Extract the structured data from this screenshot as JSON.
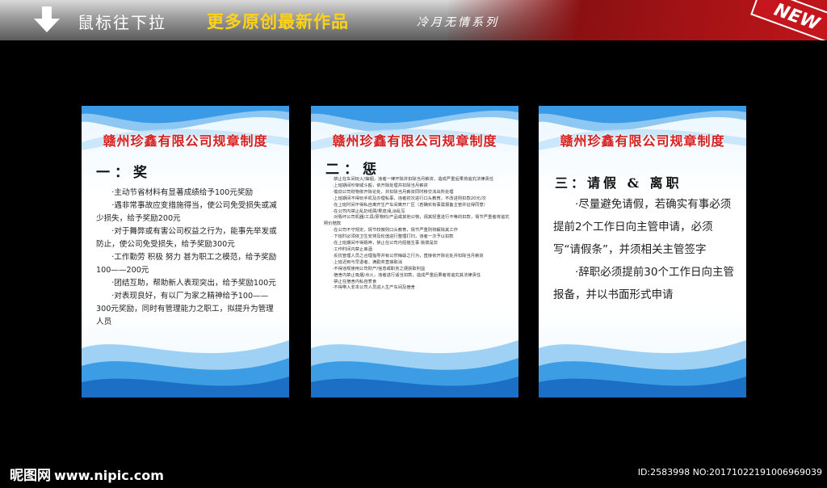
{
  "banner": {
    "scroll_hint": "鼠标往下拉",
    "promo": "更多原创最新作品",
    "series": "冷月无情系列",
    "new_tag": "NEW"
  },
  "panels": [
    {
      "title": "赣州珍鑫有限公司规章制度",
      "heading": "一：奖",
      "paragraphs": [
        "·主动节省材料有显著成绩给予100元奖励",
        "·遇非常事故应变措施得当，使公司免受损失或减少损失，给予奖励200元",
        "·对于舞弊或有害公司权益之行为，能事先举发或防止，使公司免受损失，给予奖励300元",
        "·工作勤劳 积极 努力 甚为职工之模范，给予奖励100——200元",
        "·团结互助，帮助新人表现突出，给予奖励100元",
        "·对表现良好，有以厂为家之精神给予100——300元奖励，同时有管理能力之职工，拟提升为管理人员"
      ]
    },
    {
      "title": "赣州珍鑫有限公司规章制度",
      "heading": "二：惩",
      "paragraphs": [
        "·禁止在车间玩火/抽烟，违者一律开除并扣除当月薪资，造成严重后果将追究法律责任",
        "·上班期间吵架或斗殴，依开除处理并扣除当月薪资",
        "·偷窃公司财物依开除论处，并扣除当月薪资同时移交派出所处理",
        "·上班期间不得玩手机及办理私事，违者初次进行口头教育，不改进则扣款20元/次",
        "·在上班时间不得私自离开生产车间离开厂区（若确实有事需报备主管并征得同意）",
        "·在公司内禁止乱扔纸屑/果皮/乱涂乱写",
        "·对毁坏公司机器/工具/原物料/产品或其他公物，视其轻重进行不等的扣款，情节严重者将追究照价赔款",
        "·在公司不守规定，情节较微则口头教育，情节严重则将解除其工作",
        "·下班时必须依卫生安排及轮值进行整理打扫，违者一次予以扣款",
        "·在上班期间不得嬉哗，禁止在公司内招摇生事 挑拨是非",
        "·工作时间内禁止串酒",
        "·反抗管理人员之合理指导并有公然侮辱之行为，直接依开除论处并扣除当月薪资",
        "·上班迟到与早退者，满勤奖直接取消",
        "·不得违规使用公司财产/信息或职务之便获取利益",
        "·宿舍内禁止吸烟/点火，违者进行适当扣款，造成严重后果者将追究其法律责任",
        "·禁止在宿舍内私自煮食",
        "·不得带入非本公司人员进入生产车间及宿舍"
      ]
    },
    {
      "title": "赣州珍鑫有限公司规章制度",
      "heading": "三：请假 & 离职",
      "paragraphs": [
        "·尽量避免请假，若确实有事必须提前2个工作日向主管申请，必须写“请假条”，并须相关主管签字",
        "·辞职必须提前30个工作日向主管报备，并以书面形式申请"
      ]
    }
  ],
  "footer": {
    "logo": "昵图网",
    "site": "www.nipic.com",
    "id_line": "ID:2583998 NO:20171022191006969039"
  },
  "colors": {
    "title_red": "#d42020",
    "wave_blue": "#1a7fd6",
    "banner_red": "#c0151a",
    "promo_yellow": "#ffd21a"
  }
}
